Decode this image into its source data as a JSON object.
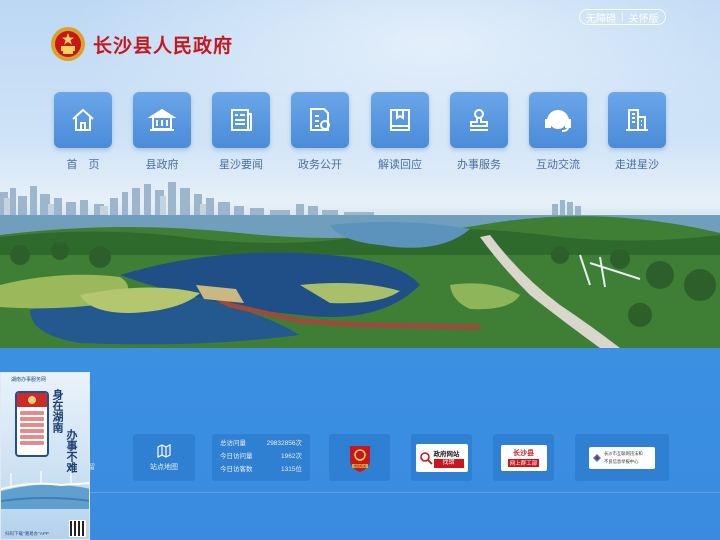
{
  "header": {
    "site_title": "长沙县人民政府",
    "top_links": [
      "无障碍",
      "关怀版"
    ]
  },
  "nav": {
    "items": [
      {
        "label": "首　页",
        "icon": "home-icon"
      },
      {
        "label": "县政府",
        "icon": "government-building-icon"
      },
      {
        "label": "星沙要闻",
        "icon": "news-icon"
      },
      {
        "label": "政务公开",
        "icon": "open-affairs-icon"
      },
      {
        "label": "解读回应",
        "icon": "book-icon"
      },
      {
        "label": "办事服务",
        "icon": "stamp-icon"
      },
      {
        "label": "互动交流",
        "icon": "headset-icon"
      },
      {
        "label": "走进星沙",
        "icon": "city-building-icon"
      }
    ]
  },
  "footer": {
    "partial_label": "留",
    "sitemap_label": "站点地图",
    "stats": [
      {
        "label": "总访问量",
        "value": "29832856次"
      },
      {
        "label": "今日访问量",
        "value": "1962次"
      },
      {
        "label": "今日访客数",
        "value": "1315位"
      }
    ],
    "badges": {
      "gov_badge_text": "党政机关",
      "gov_site_line1": "政府网站",
      "gov_site_line2": "找错",
      "county_line1": "长沙县",
      "county_line2": "网上群工部",
      "report_line1": "长沙市互联网违法和",
      "report_line2": "不良信息举报中心"
    }
  },
  "float_ad": {
    "top_text": "湖南办事服务网",
    "vertical_1": "身在湖南",
    "vertical_2": "办事不难",
    "bottom_text": "扫码下载\"湘易办\"APP"
  },
  "colors": {
    "title_red": "#c8161d",
    "nav_blue": "#4b8bd8",
    "bottom_blue": "#3a8be0"
  }
}
